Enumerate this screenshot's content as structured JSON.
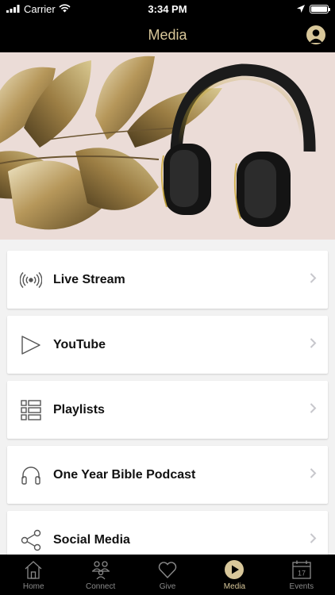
{
  "status_bar": {
    "carrier": "Carrier",
    "time": "3:34 PM",
    "battery_level": 1.0
  },
  "nav": {
    "title": "Media",
    "profile_icon": "person-circle-icon"
  },
  "hero": {
    "image_icon": "headphones-icon"
  },
  "menu": [
    {
      "label": "Live Stream",
      "icon": "broadcast-icon"
    },
    {
      "label": "YouTube",
      "icon": "play-outline-icon"
    },
    {
      "label": "Playlists",
      "icon": "list-icon"
    },
    {
      "label": "One Year Bible Podcast",
      "icon": "headphones-icon"
    },
    {
      "label": "Social Media",
      "icon": "share-icon"
    }
  ],
  "tabs": [
    {
      "label": "Home",
      "icon": "home-icon",
      "active": false
    },
    {
      "label": "Connect",
      "icon": "people-icon",
      "active": false
    },
    {
      "label": "Give",
      "icon": "heart-icon",
      "active": false
    },
    {
      "label": "Media",
      "icon": "play-circle-icon",
      "active": true
    },
    {
      "label": "Events",
      "icon": "calendar-icon",
      "active": false,
      "date": "17"
    }
  ],
  "colors": {
    "accent": "#d8c79a",
    "bar_bg": "#000000",
    "page_bg": "#f2f2f2",
    "inactive_tab": "#8a8a8a"
  }
}
